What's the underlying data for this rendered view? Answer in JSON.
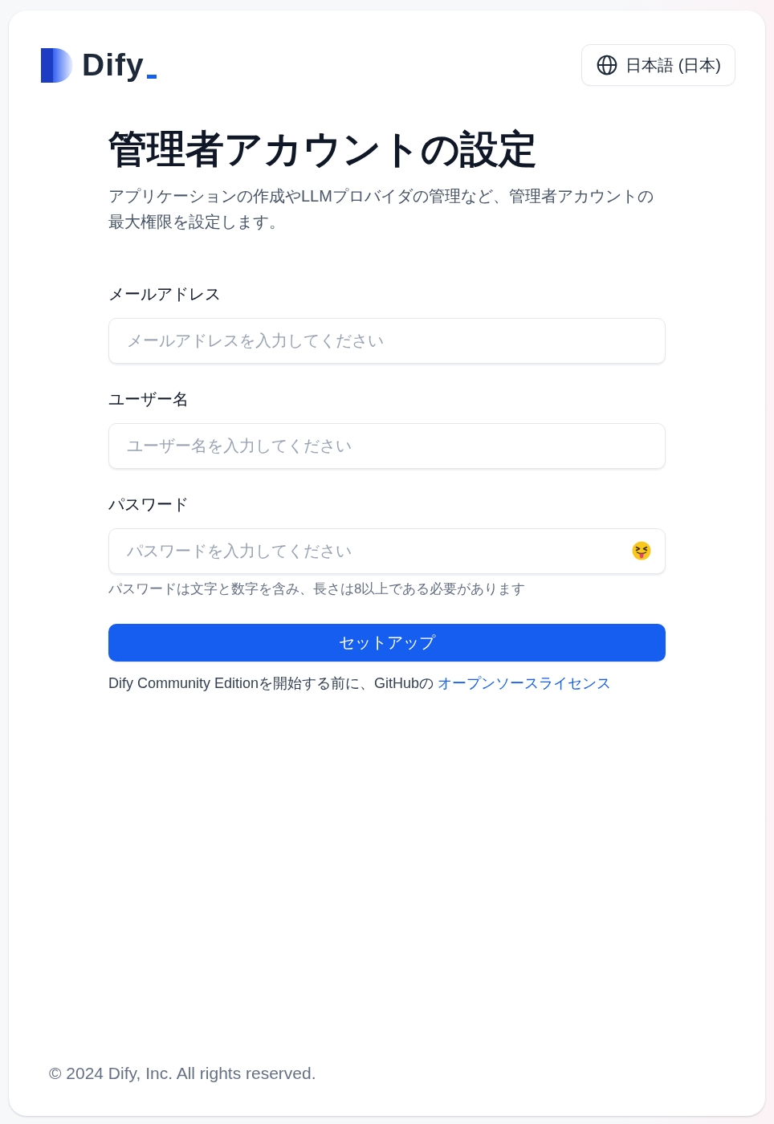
{
  "header": {
    "logo_text": "Dify",
    "language_button": "日本語 (日本)"
  },
  "title": "管理者アカウントの設定",
  "subtitle": "アプリケーションの作成やLLMプロバイダの管理など、管理者アカウントの最大権限を設定します。",
  "form": {
    "fields": [
      {
        "kind": "text",
        "label": "メールアドレス",
        "placeholder": "メールアドレスを入力してください"
      },
      {
        "kind": "text",
        "label": "ユーザー名",
        "placeholder": "ユーザー名を入力してください"
      },
      {
        "kind": "password",
        "label": "パスワード",
        "placeholder": "パスワードを入力してください",
        "hint": "パスワードは文字と数字を含み、長さは8以上である必要があります"
      }
    ],
    "submit_button": "セットアップ",
    "license_notice": {
      "text": "Dify Community Editionを開始する前に、GitHubの",
      "link": "オープンソースライセンス"
    }
  },
  "footer": "© 2024 Dify, Inc. All rights reserved."
}
